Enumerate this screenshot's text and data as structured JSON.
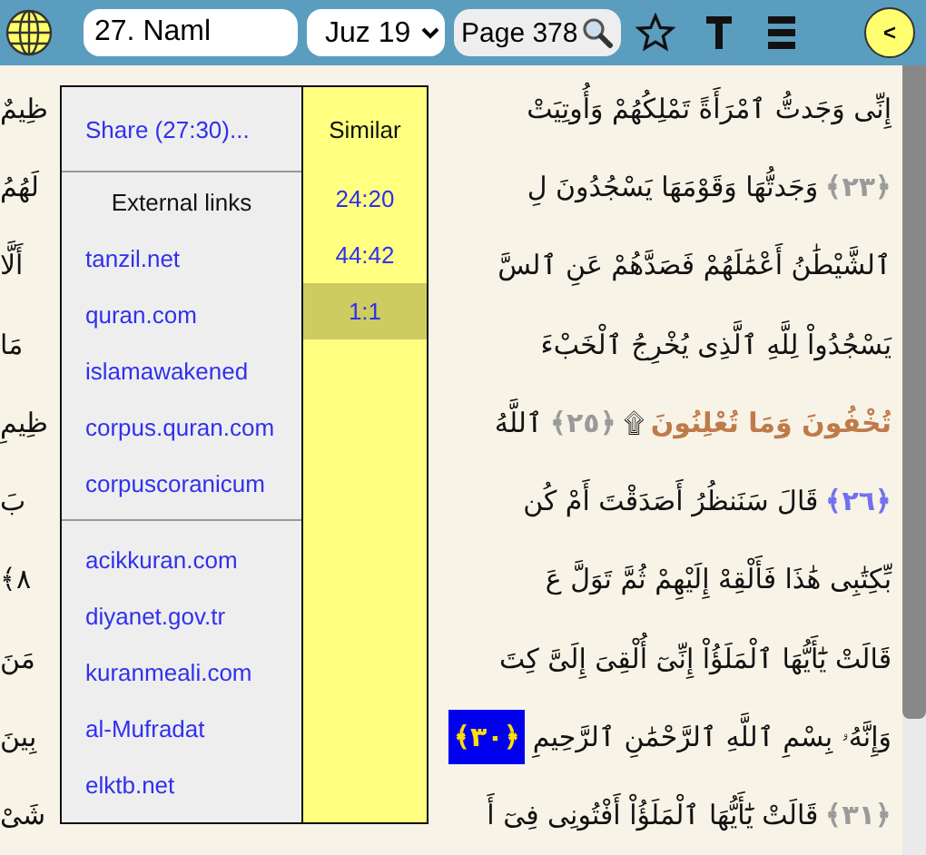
{
  "toolbar": {
    "surah": "27. Naml",
    "juz": "Juz 19",
    "page": "Page 378"
  },
  "lines": [
    {
      "left": "ظِيمٌ",
      "segments": [
        {
          "kind": "word",
          "text": "إِنِّى وَجَدتُّ ٱمْرَأَةً تَمْلِكُهُمْ وَأُوتِيَتْ"
        }
      ]
    },
    {
      "left": "لَهُمُ",
      "segments": [
        {
          "kind": "marker",
          "text": "﴿٢٣﴾",
          "color": "#9a9a9a",
          "selected": false
        },
        {
          "kind": "word",
          "text": "وَجَدتُّهَا وَقَوْمَهَا يَسْجُدُونَ لِ"
        }
      ]
    },
    {
      "left": "أَلَّا",
      "segments": [
        {
          "kind": "word",
          "text": "ٱلشَّيْطَٰنُ أَعْمَٰلَهُمْ فَصَدَّهُمْ عَنِ ٱلسَّ"
        }
      ]
    },
    {
      "left": "مَا",
      "segments": [
        {
          "kind": "word",
          "text": "يَسْجُدُواْ لِلَّهِ ٱلَّذِى يُخْرِجُ ٱلْخَبْءَ"
        }
      ]
    },
    {
      "left": "ظِيمِ",
      "segments": [
        {
          "kind": "sajda",
          "text": "تُخْفُونَ وَمَا تُعْلِنُونَ"
        },
        {
          "kind": "word",
          "text": "۩"
        },
        {
          "kind": "marker",
          "text": "﴿٢٥﴾",
          "color": "#9a9a9a",
          "selected": false
        },
        {
          "kind": "word",
          "text": "ٱللَّهُ"
        }
      ]
    },
    {
      "left": "بَ",
      "segments": [
        {
          "kind": "marker",
          "text": "﴿٢٦﴾",
          "color": "#7070f0",
          "selected": false
        },
        {
          "kind": "word",
          "text": "قَالَ سَنَنظُرُ أَصَدَقْتَ أَمْ كُن"
        }
      ]
    },
    {
      "left": "٨﴾",
      "segments": [
        {
          "kind": "word",
          "text": "بِّكِتَٰبِى هَٰذَا فَأَلْقِهْ إِلَيْهِمْ ثُمَّ تَوَلَّ عَ"
        }
      ]
    },
    {
      "left": "مَنَ",
      "segments": [
        {
          "kind": "word",
          "text": "قَالَتْ يَٰٓأَيُّهَا ٱلْمَلَؤُاْ إِنِّىٓ أُلْقِىَ إِلَىَّ كِتَ"
        }
      ]
    },
    {
      "left": "بِينَ",
      "segments": [
        {
          "kind": "word",
          "text": "وَإِنَّهُۥ بِسْمِ ٱللَّهِ ٱلرَّحْمَٰنِ ٱلرَّحِيمِ"
        },
        {
          "kind": "marker",
          "text": "﴿٣٠﴾",
          "selected": true
        }
      ]
    },
    {
      "left": "شَىْ",
      "segments": [
        {
          "kind": "marker",
          "text": "﴿٣١﴾",
          "color": "#9a9a9a",
          "selected": false
        },
        {
          "kind": "word",
          "text": "قَالَتْ يَٰٓأَيُّهَا ٱلْمَلَؤُاْ أَفْتُونِى فِىٓ أَ"
        }
      ]
    }
  ],
  "popup": {
    "share": "Share (27:30)...",
    "links_heading": "External links",
    "link_groups": [
      [
        "tanzil.net",
        "quran.com",
        "islamawakened",
        "corpus.quran.com",
        "corpuscoranicum"
      ],
      [
        "acikkuran.com",
        "diyanet.gov.tr",
        "kuranmeali.com",
        "al-Mufradat",
        "elktb.net"
      ]
    ],
    "similar_heading": "Similar",
    "similar": [
      {
        "label": "24:20",
        "selected": false
      },
      {
        "label": "44:42",
        "selected": false
      },
      {
        "label": "1:1",
        "selected": true
      }
    ]
  },
  "back_button": "<"
}
